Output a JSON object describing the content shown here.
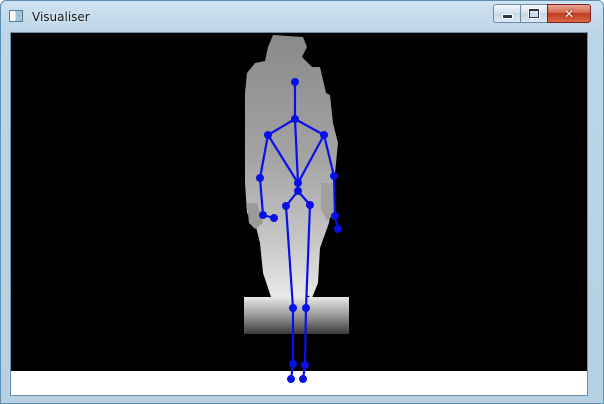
{
  "window": {
    "title": "Visualiser",
    "icon": "app-window-icon",
    "controls": {
      "minimize": "minimize-icon",
      "maximize": "maximize-icon",
      "close": "close-icon",
      "close_glyph": "✕"
    }
  },
  "scene": {
    "background": "#000000",
    "skeleton_color": "#0a10e8",
    "depth_silhouette": "grayscale-depth-image"
  }
}
